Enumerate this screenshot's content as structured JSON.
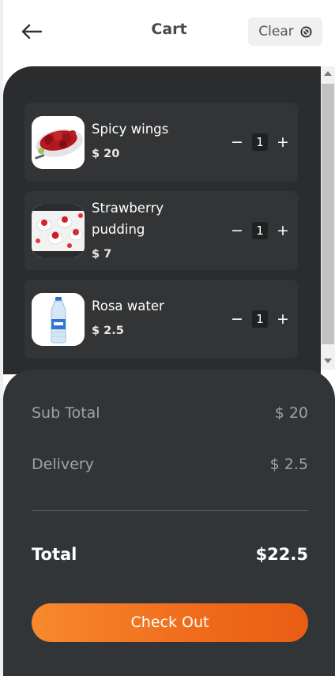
{
  "header": {
    "title": "Cart",
    "clear_label": "Clear",
    "back_icon": "arrow-left-icon",
    "clear_icon": "cancel-circle-icon"
  },
  "cart": {
    "items": [
      {
        "name": "Spicy wings",
        "price": "$ 20",
        "quantity": "1",
        "minus": "−",
        "plus": "+"
      },
      {
        "name": "Strawberry pudding",
        "price": "$ 7",
        "quantity": "1",
        "minus": "−",
        "plus": "+"
      },
      {
        "name": "Rosa water",
        "price": "$ 2.5",
        "quantity": "1",
        "minus": "−",
        "plus": "+"
      }
    ]
  },
  "summary": {
    "subtotal_label": "Sub Total",
    "subtotal_value": "$ 20",
    "delivery_label": "Delivery",
    "delivery_value": "$ 2.5",
    "total_label": "Total",
    "total_value": "$22.5",
    "checkout_label": "Check Out"
  },
  "colors": {
    "accent": "#f07a25",
    "panel": "#2b2c2e",
    "card": "#333436",
    "summary": "#323538"
  }
}
